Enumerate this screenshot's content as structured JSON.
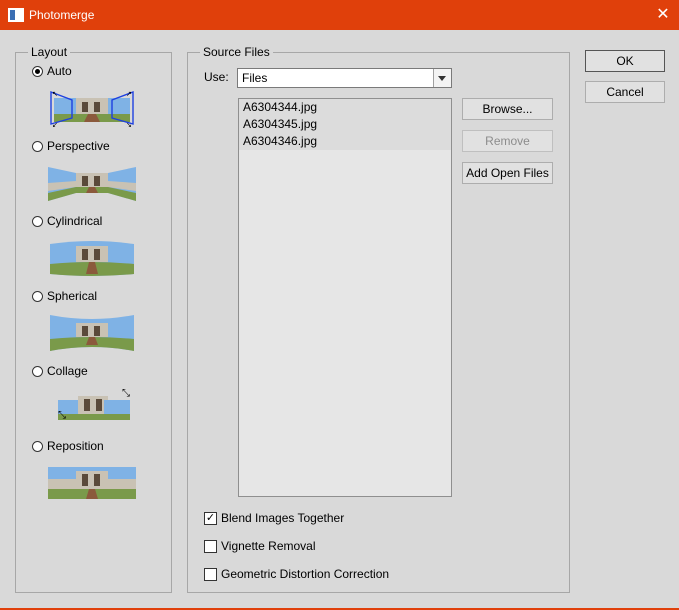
{
  "window": {
    "title": "Photomerge",
    "close_glyph": "✕"
  },
  "layout": {
    "group_label": "Layout",
    "options": [
      {
        "label": "Auto",
        "checked": true
      },
      {
        "label": "Perspective",
        "checked": false
      },
      {
        "label": "Cylindrical",
        "checked": false
      },
      {
        "label": "Spherical",
        "checked": false
      },
      {
        "label": "Collage",
        "checked": false
      },
      {
        "label": "Reposition",
        "checked": false
      }
    ]
  },
  "source": {
    "group_label": "Source Files",
    "use_label": "Use:",
    "use_value": "Files",
    "files": [
      "A6304344.jpg",
      "A6304345.jpg",
      "A6304346.jpg"
    ],
    "browse_label": "Browse...",
    "remove_label": "Remove",
    "add_open_label": "Add Open Files",
    "options": [
      {
        "label": "Blend Images Together",
        "checked": true
      },
      {
        "label": "Vignette Removal",
        "checked": false
      },
      {
        "label": "Geometric Distortion Correction",
        "checked": false
      }
    ]
  },
  "buttons": {
    "ok": "OK",
    "cancel": "Cancel"
  },
  "colors": {
    "titlebar": "#e0400b",
    "dialog_bg": "#d9d9d9"
  },
  "icons": {
    "check_glyph": "✓"
  }
}
